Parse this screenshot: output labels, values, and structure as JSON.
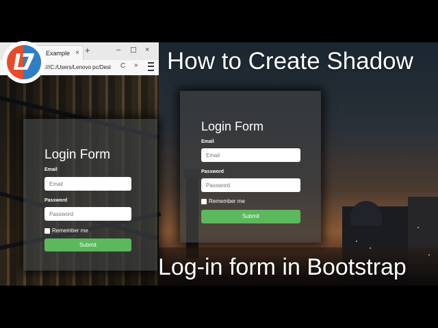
{
  "logo": {
    "icon": "l7-logo-icon",
    "colors": {
      "red": "#e84b2a",
      "blue": "#2e7fc6"
    }
  },
  "browser": {
    "tab_title": "Example",
    "tab_close": "×",
    "new_tab": "+",
    "min": "–",
    "max": "☐",
    "close": "×",
    "url": "e:///C:/Users/Lenovo pc/Desl",
    "reload": "C",
    "more": "»"
  },
  "video_title": {
    "line1": "How to Create Shadow",
    "line2": "Log-in form in Bootstrap"
  },
  "form_left": {
    "title": "Login Form",
    "email_label": "Email",
    "email_placeholder": "Email",
    "password_label": "Password",
    "password_placeholder": "Password",
    "remember_label": "Remember me",
    "submit_label": "Submit"
  },
  "form_right": {
    "title": "Login Form",
    "email_label": "Email",
    "email_placeholder": "Email",
    "password_label": "Password",
    "password_placeholder": "Password",
    "remember_label": "Remember me",
    "submit_label": "Submit"
  },
  "colors": {
    "submit_green": "#5cb85c",
    "card_bg": "#3c3e40"
  }
}
